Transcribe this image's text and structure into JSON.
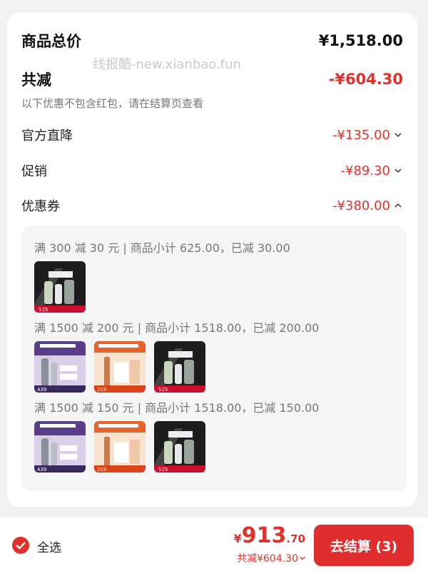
{
  "summary": {
    "total_label": "商品总价",
    "total_value": "¥1,518.00",
    "reduce_label": "共减",
    "reduce_value": "-¥604.30",
    "note": "以下优惠不包含红包，请在结算页查看",
    "watermark": "线报酷-new.xianbao.fun"
  },
  "discounts": [
    {
      "label": "官方直降",
      "value": "-¥135.00",
      "icon": "chevron-down-icon"
    },
    {
      "label": "促销",
      "value": "-¥89.30",
      "icon": "chevron-down-icon"
    },
    {
      "label": "优惠券",
      "value": "-¥380.00",
      "icon": "chevron-up-icon"
    }
  ],
  "coupons": [
    {
      "title": "满 300 减 30 元 | 商品小计 625.00，已减 30.00",
      "products": [
        "dark-serum-kit-525"
      ]
    },
    {
      "title": "满 1500 减 200 元 | 商品小计 1518.00，已减 200.00",
      "products": [
        "purple-serum-439",
        "orange-cream-319",
        "dark-serum-kit-525"
      ]
    },
    {
      "title": "满 1500 减 150 元 | 商品小计 1518.00，已减 150.00",
      "products": [
        "purple-serum-439",
        "orange-cream-319",
        "dark-serum-kit-525"
      ]
    }
  ],
  "bottom_bar": {
    "select_all": "全选",
    "total_currency": "¥",
    "total_int": "913",
    "total_dec": ".70",
    "saved": "共减¥604.30",
    "checkout": "去结算 (3)"
  },
  "colors": {
    "accent": "#e0322b",
    "button": "#e02d2d"
  }
}
